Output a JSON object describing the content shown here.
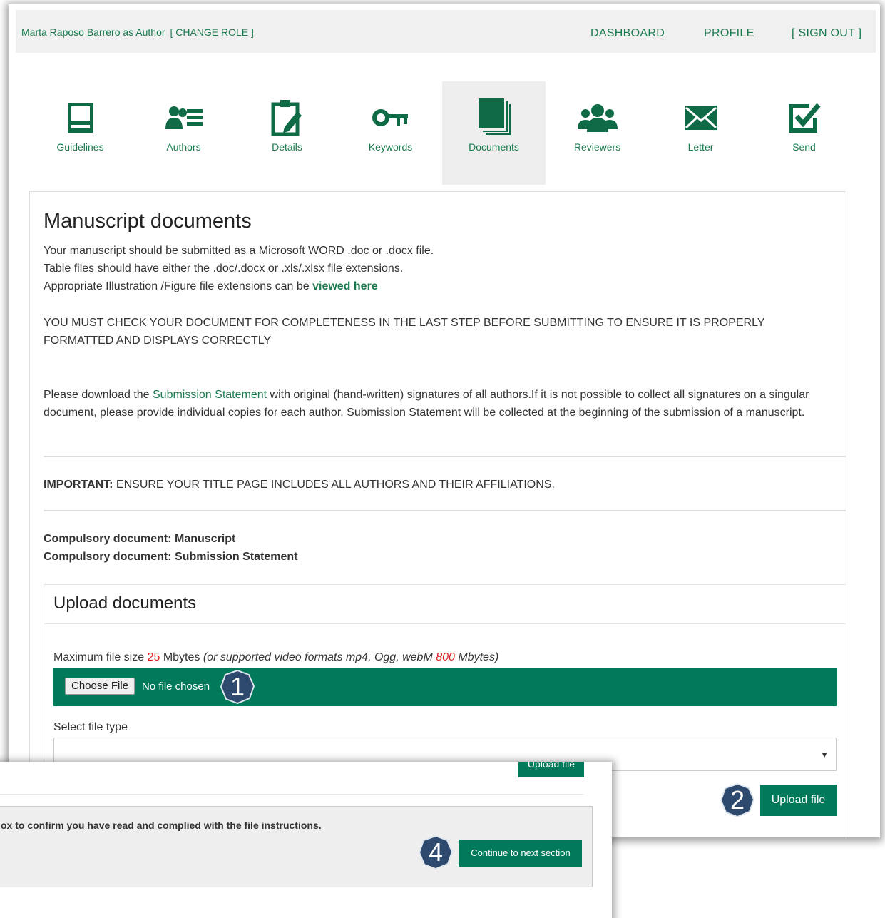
{
  "header": {
    "user": "Marta Raposo Barrero as Author",
    "change_role": "[ CHANGE ROLE ]",
    "nav": [
      "DASHBOARD",
      "PROFILE",
      "[ SIGN OUT ]"
    ]
  },
  "steps": [
    {
      "label": "Guidelines",
      "icon": "book-icon"
    },
    {
      "label": "Authors",
      "icon": "authors-icon"
    },
    {
      "label": "Details",
      "icon": "clipboard-edit-icon"
    },
    {
      "label": "Keywords",
      "icon": "key-icon"
    },
    {
      "label": "Documents",
      "icon": "documents-icon",
      "active": true
    },
    {
      "label": "Reviewers",
      "icon": "users-icon"
    },
    {
      "label": "Letter",
      "icon": "envelope-icon"
    },
    {
      "label": "Send",
      "icon": "check-square-icon"
    }
  ],
  "panel": {
    "title": "Manuscript documents",
    "line1": "Your manuscript should be submitted as a Microsoft WORD .doc or .docx file.",
    "line2": "Table files should have either the .doc/.docx or .xls/.xlsx file extensions.",
    "line3_prefix": "Appropriate Illustration /Figure file extensions can be ",
    "line3_link": "viewed here",
    "warning": "YOU MUST CHECK YOUR DOCUMENT FOR COMPLETENESS IN THE LAST STEP BEFORE SUBMITTING TO ENSURE IT IS PROPERLY FORMATTED AND DISPLAYS CORRECTLY",
    "statement_prefix": "Please download the ",
    "statement_link": "Submission Statement",
    "statement_suffix": " with original (hand-written) signatures of all authors.If it is not possible to collect all signatures on a singular document, please provide individual copies for each author. Submission Statement will be collected at the beginning of the submission of a manuscript.",
    "important_label": "IMPORTANT:",
    "important_text": " ENSURE YOUR TITLE PAGE INCLUDES ALL AUTHORS AND THEIR AFFILIATIONS.",
    "compulsory1": "Compulsory document: Manuscript",
    "compulsory2": "Compulsory document: Submission Statement"
  },
  "upload": {
    "title": "Upload documents",
    "max_prefix": "Maximum file size ",
    "max_value": "25",
    "max_unit": " Mbytes ",
    "video_prefix": "(or supported video formats mp4, Ogg, webM ",
    "video_value": "800",
    "video_suffix": " Mbytes)",
    "choose_file": "Choose File",
    "no_file": "No file chosen",
    "select_label": "Select file type",
    "select_value": "",
    "upload_button": "Upload file"
  },
  "overlay": {
    "confirm_text": "ox to confirm you have read and complied with the file instructions.",
    "continue_button": "Continue to next section",
    "cut_button": "Upload file"
  },
  "badges": [
    "1",
    "2",
    "4"
  ],
  "colors": {
    "brand": "#007a5a",
    "link": "#1a7a4e",
    "accent_red": "#e02020",
    "badge": "#2d4a6e"
  }
}
